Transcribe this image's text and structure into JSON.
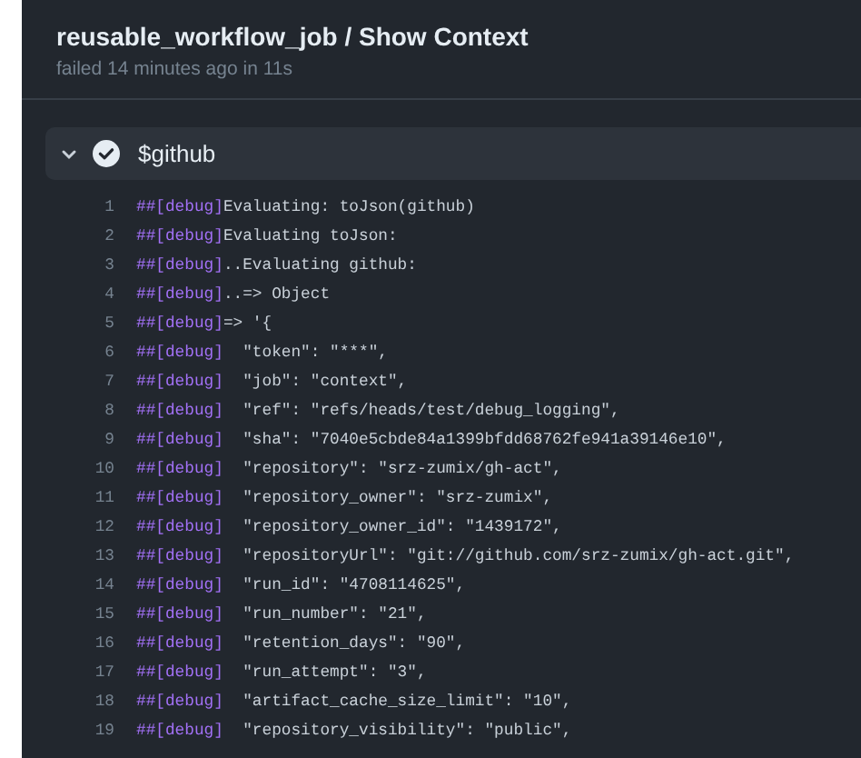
{
  "job": {
    "title": "reusable_workflow_job / Show Context",
    "status": "failed 14 minutes ago in 11s"
  },
  "step": {
    "name": "$github",
    "expanded": true,
    "succeeded": true
  },
  "log": [
    {
      "number": "1",
      "tag": "##[debug]",
      "text": "Evaluating: toJson(github)"
    },
    {
      "number": "2",
      "tag": "##[debug]",
      "text": "Evaluating toJson:"
    },
    {
      "number": "3",
      "tag": "##[debug]",
      "text": "..Evaluating github:"
    },
    {
      "number": "4",
      "tag": "##[debug]",
      "text": "..=> Object"
    },
    {
      "number": "5",
      "tag": "##[debug]",
      "text": "=> '{"
    },
    {
      "number": "6",
      "tag": "##[debug]",
      "text": "  \"token\": \"***\","
    },
    {
      "number": "7",
      "tag": "##[debug]",
      "text": "  \"job\": \"context\","
    },
    {
      "number": "8",
      "tag": "##[debug]",
      "text": "  \"ref\": \"refs/heads/test/debug_logging\","
    },
    {
      "number": "9",
      "tag": "##[debug]",
      "text": "  \"sha\": \"7040e5cbde84a1399bfdd68762fe941a39146e10\","
    },
    {
      "number": "10",
      "tag": "##[debug]",
      "text": "  \"repository\": \"srz-zumix/gh-act\","
    },
    {
      "number": "11",
      "tag": "##[debug]",
      "text": "  \"repository_owner\": \"srz-zumix\","
    },
    {
      "number": "12",
      "tag": "##[debug]",
      "text": "  \"repository_owner_id\": \"1439172\","
    },
    {
      "number": "13",
      "tag": "##[debug]",
      "text": "  \"repositoryUrl\": \"git://github.com/srz-zumix/gh-act.git\","
    },
    {
      "number": "14",
      "tag": "##[debug]",
      "text": "  \"run_id\": \"4708114625\","
    },
    {
      "number": "15",
      "tag": "##[debug]",
      "text": "  \"run_number\": \"21\","
    },
    {
      "number": "16",
      "tag": "##[debug]",
      "text": "  \"retention_days\": \"90\","
    },
    {
      "number": "17",
      "tag": "##[debug]",
      "text": "  \"run_attempt\": \"3\","
    },
    {
      "number": "18",
      "tag": "##[debug]",
      "text": "  \"artifact_cache_size_limit\": \"10\","
    },
    {
      "number": "19",
      "tag": "##[debug]",
      "text": "  \"repository_visibility\": \"public\","
    }
  ]
}
